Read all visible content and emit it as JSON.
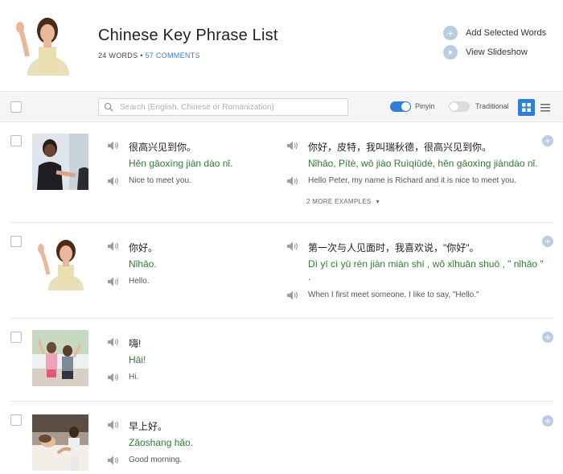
{
  "header": {
    "title": "Chinese Key Phrase List",
    "words": "24 WORDS",
    "separator": " • ",
    "comments": "57 COMMENTS",
    "actions": {
      "add": "Add Selected Words",
      "slideshow": "View Slideshow"
    }
  },
  "toolbar": {
    "search_placeholder": "Search (English, Chinese or Romanization)",
    "pinyin_label": "Pinyin",
    "traditional_label": "Traditional",
    "pinyin_on": true,
    "traditional_on": false
  },
  "rows": [
    {
      "zh": "很高兴见到你。",
      "py": "Hěn gāoxìng jiàn dào nǐ.",
      "en": "Nice to meet you.",
      "ex_zh": "你好，皮特，我叫瑞秋德，很高兴见到你。",
      "ex_py": "Nǐhǎo, Pítè, wǒ jiào Ruìqiūdé, hěn gāoxìng jiàndào nǐ.",
      "ex_en": "Hello Peter, my name is Richard and it is nice to meet you.",
      "more": "2 MORE EXAMPLES"
    },
    {
      "zh": "你好。",
      "py": "Nǐhǎo.",
      "en": "Hello.",
      "ex_zh": "第一次与人见面时，我喜欢说，\"你好\"。",
      "ex_py": "Dì yī cì yǔ rén jiàn miàn shí , wǒ xǐhuān shuō , \" nǐhǎo \"",
      "ex_py2": ".",
      "ex_en": "When I first meet someone, I like to say, \"Hello.\""
    },
    {
      "zh": "嗨!",
      "py": "Hāi!",
      "en": "Hi."
    },
    {
      "zh": "早上好。",
      "py": "Zǎoshang hǎo.",
      "en": "Good morning."
    }
  ],
  "colors": {
    "accent": "#2f7fd6",
    "pinyin_green": "#2e7d32",
    "plus_circle": "#b9cde3"
  }
}
